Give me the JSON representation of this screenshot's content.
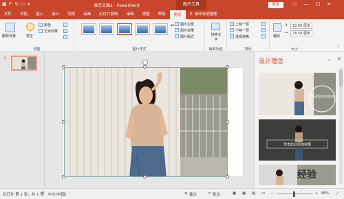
{
  "titlebar": {
    "doc_title": "演示文稿1 - PowerPoint",
    "tool_label": "图片工具",
    "login_label": "登录"
  },
  "tabs": [
    "文件",
    "开始",
    "插入",
    "设计",
    "切换",
    "动画",
    "幻灯片放映",
    "审阅",
    "视图",
    "帮助",
    "格式",
    "操作说明搜索"
  ],
  "ribbon": {
    "remove_bg": "删除背景",
    "correct": "校正",
    "color": "颜色",
    "art_effect": "艺术效果",
    "adjust_label": "调整",
    "border": "图片边框",
    "effect": "图片效果",
    "layout": "图片版式",
    "styles_label": "图片样式",
    "alt_text": "替换文字",
    "access_label": "辅助功能",
    "bring_forward": "上移一层",
    "send_backward": "下移一层",
    "select_pane": "选择窗格",
    "arrange_label": "排列",
    "crop": "裁剪",
    "height": "19.05 厘米",
    "width": "28.58 厘米",
    "size_label": "大小"
  },
  "slides_panel": {
    "slide_number": "1"
  },
  "design_panel": {
    "title": "设计理念",
    "card2_text": "单击此处添加标题",
    "card1_text": "单击此处添加标题"
  },
  "statusbar": {
    "slide_info": "幻灯片 第 1 张，共 1 张",
    "language": "中文(中国)",
    "notes": "备注",
    "comments": "批注",
    "zoom": "48%"
  },
  "watermark": "经验",
  "colors": {
    "accent": "#c8462b",
    "ribbon_bg": "#f3f3f3"
  }
}
